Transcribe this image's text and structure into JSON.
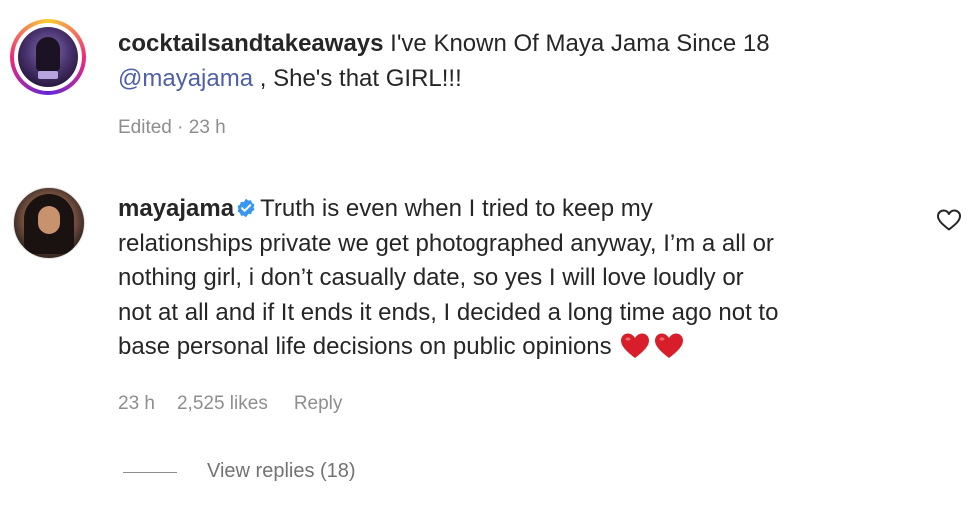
{
  "comments": [
    {
      "username": "cocktailsandtakeaways",
      "text_line1": "I've Known Of Maya Jama Since 18",
      "mention": "@mayajama",
      "text_line2": ", She's that GIRL!!!",
      "meta_time": "Edited · 23 h"
    },
    {
      "username": "mayajama",
      "verified": true,
      "lines": [
        "Truth is even when I tried to keep my",
        "relationships private we get photographed anyway, I’m a all or",
        "nothing girl, i don’t casually date, so yes I will love loudly or",
        "not at all and if It ends it ends, I decided a long time ago not to",
        "base personal life decisions on public opinions"
      ],
      "emoji": [
        "red-heart",
        "red-heart"
      ],
      "time": "23 h",
      "likes": "2,525 likes",
      "reply": "Reply",
      "view_replies": "View replies (18)"
    }
  ],
  "colors": {
    "mention": "#4f5fa8",
    "meta": "#8e8e8e",
    "verified": "#3897f0",
    "heart": "#d81e2a"
  }
}
